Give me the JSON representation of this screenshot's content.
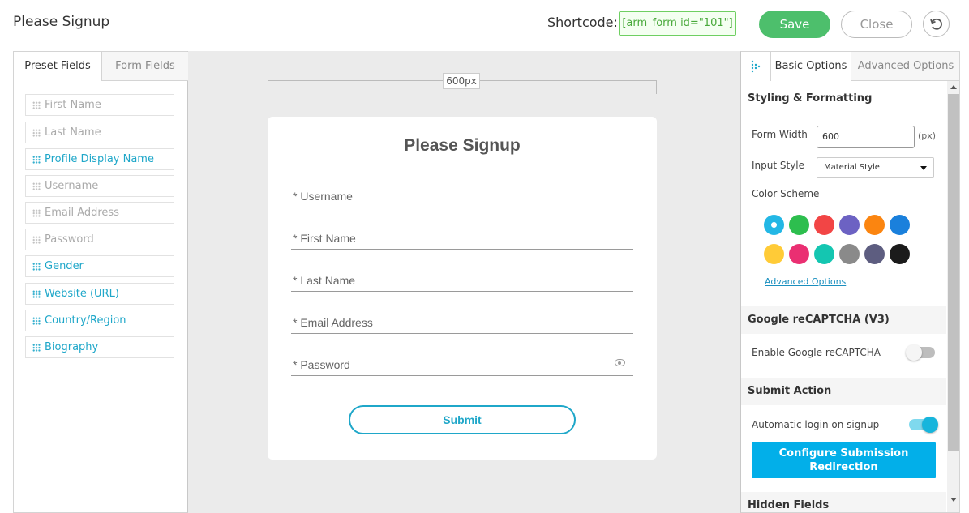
{
  "header": {
    "title": "Please Signup",
    "shortcode_label": "Shortcode:",
    "shortcode_value": "[arm_form id=\"101\"]",
    "save_label": "Save",
    "close_label": "Close",
    "reset_icon": "reset-icon"
  },
  "left_panel": {
    "tabs": [
      {
        "label": "Preset Fields",
        "active": true
      },
      {
        "label": "Form Fields",
        "active": false
      }
    ],
    "fields": [
      {
        "label": "First Name",
        "enabled": false
      },
      {
        "label": "Last Name",
        "enabled": false
      },
      {
        "label": "Profile Display Name",
        "enabled": true
      },
      {
        "label": "Username",
        "enabled": false
      },
      {
        "label": "Email Address",
        "enabled": false
      },
      {
        "label": "Password",
        "enabled": false
      },
      {
        "label": "Gender",
        "enabled": true
      },
      {
        "label": "Website (URL)",
        "enabled": true
      },
      {
        "label": "Country/Region",
        "enabled": true
      },
      {
        "label": "Biography",
        "enabled": true
      }
    ]
  },
  "canvas": {
    "width_label": "600px",
    "form": {
      "title": "Please Signup",
      "inputs": [
        {
          "label": "* Username"
        },
        {
          "label": "* First Name"
        },
        {
          "label": "* Last Name"
        },
        {
          "label": "* Email Address"
        },
        {
          "label": "* Password"
        }
      ],
      "submit_label": "Submit"
    }
  },
  "right_panel": {
    "tabs": [
      {
        "label": "Basic Options",
        "active": true
      },
      {
        "label": "Advanced Options",
        "active": false
      }
    ],
    "styling": {
      "heading": "Styling & Formatting",
      "form_width_label": "Form Width",
      "form_width_value": "600",
      "form_width_unit": "(px)",
      "input_style_label": "Input Style",
      "input_style_value": "Material Style",
      "color_scheme_label": "Color Scheme",
      "colors": [
        "#23b7e5",
        "#2dbe4e",
        "#f24545",
        "#6c62c3",
        "#fb8510",
        "#1a80dc",
        "#ffcb37",
        "#ea2f72",
        "#14c6b1",
        "#8a8a8a",
        "#5d5d80",
        "#1b1b1b"
      ],
      "selected_color_index": 0,
      "advanced_link": "Advanced Options"
    },
    "recaptcha": {
      "heading": "Google reCAPTCHA (V3)",
      "enable_label": "Enable Google reCAPTCHA",
      "enabled": false
    },
    "submit_action": {
      "heading": "Submit Action",
      "auto_login_label": "Automatic login on signup",
      "auto_login_enabled": true,
      "redirect_button_label": "Configure Submission Redirection"
    },
    "hidden_fields": {
      "heading": "Hidden Fields"
    }
  }
}
